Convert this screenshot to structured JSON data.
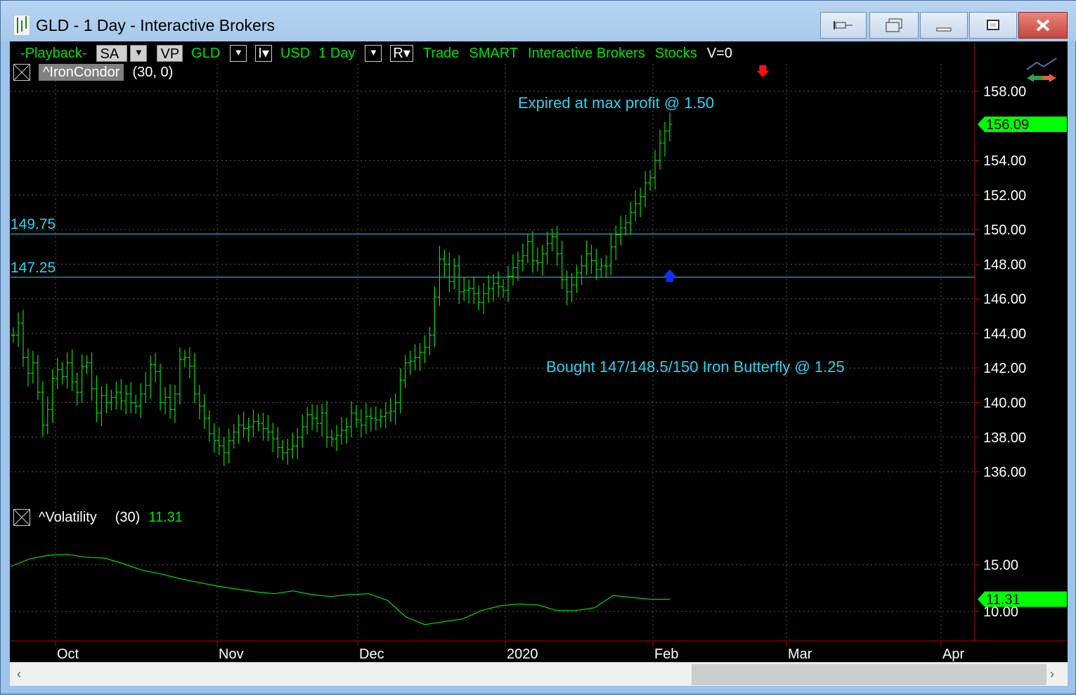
{
  "window": {
    "title": "GLD - 1 Day - Interactive Brokers",
    "buttons": [
      "pin-icon",
      "restore-window-icon",
      "minimize-icon",
      "maximize-icon",
      "close-icon"
    ]
  },
  "toolbar": {
    "playback": "-Playback-",
    "sa": "SA",
    "vp": "VP",
    "symbol": "GLD",
    "i_label": "I",
    "currency": "USD",
    "interval": "1 Day",
    "r_label": "R",
    "trade": "Trade",
    "route": "SMART",
    "broker": "Interactive Brokers",
    "asset": "Stocks",
    "volume": "V=0"
  },
  "price_study": {
    "name": "^IronCondor",
    "params": "(30,  0)"
  },
  "vol_study": {
    "name": "^Volatility",
    "params": "(30)",
    "value": "11.31"
  },
  "colors": {
    "bars": "#00e000",
    "annotation": "#2ad4f0",
    "axis": "#c00000",
    "grid": "#505050",
    "marker_sell": "#ff1010",
    "marker_buy": "#1030ff"
  },
  "chart_data": [
    {
      "type": "ohlc",
      "name": "GLD daily",
      "x_labels": [
        "Oct",
        "Nov",
        "Dec",
        "2020",
        "Feb",
        "Mar",
        "Apr"
      ],
      "y_ticks": [
        "158.00",
        "154.00",
        "152.00",
        "150.00",
        "148.00",
        "146.00",
        "144.00",
        "142.00",
        "140.00",
        "138.00",
        "136.00"
      ],
      "ylim": [
        134.5,
        159.5
      ],
      "last_price": "156.09",
      "lines": [
        {
          "value": 149.75,
          "label": "149.75"
        },
        {
          "value": 147.25,
          "label": "147.25"
        }
      ],
      "annotations": [
        {
          "text": "Expired at max profit @ 1.50"
        },
        {
          "text": "Bought 147/148.5/150 Iron Butterfly @ 1.25"
        }
      ],
      "markers": [
        {
          "kind": "sell",
          "bar": 153,
          "price": 158.7
        },
        {
          "kind": "buy",
          "bar": 134,
          "price": 147.3
        }
      ],
      "closes": [
        143.9,
        144.6,
        142.6,
        141.7,
        142.3,
        140.6,
        138.7,
        139.6,
        141.4,
        141.9,
        141.5,
        142.3,
        141.2,
        140.6,
        142.1,
        142.3,
        140.8,
        139.4,
        140.4,
        140.0,
        140.3,
        140.6,
        140.1,
        140.5,
        140.0,
        139.8,
        140.5,
        141.0,
        142.2,
        141.8,
        140.0,
        140.3,
        139.6,
        140.5,
        142.5,
        142.6,
        142.1,
        140.5,
        139.8,
        139.1,
        138.2,
        137.8,
        137.5,
        137.1,
        137.8,
        138.3,
        138.7,
        138.5,
        138.6,
        138.9,
        138.8,
        138.5,
        138.3,
        137.9,
        137.4,
        137.1,
        137.3,
        137.5,
        138.0,
        138.6,
        139.3,
        139.1,
        138.8,
        139.4,
        138.0,
        137.9,
        138.1,
        138.4,
        138.6,
        139.4,
        139.0,
        138.7,
        139.2,
        139.1,
        139.0,
        139.2,
        139.4,
        139.5,
        140.0,
        141.3,
        142.3,
        142.4,
        142.6,
        142.9,
        143.2,
        143.9,
        146.1,
        148.3,
        148.0,
        147.0,
        147.9,
        146.4,
        146.5,
        146.6,
        146.3,
        145.8,
        146.3,
        146.6,
        146.9,
        146.7,
        146.5,
        147.3,
        147.8,
        148.2,
        148.5,
        149.3,
        148.2,
        148.1,
        148.6,
        149.2,
        149.6,
        148.6,
        147.1,
        146.4,
        146.8,
        147.5,
        147.9,
        148.6,
        148.2,
        147.7,
        147.9,
        147.9,
        149.0,
        149.7,
        150.1,
        150.4,
        151.0,
        151.5,
        151.9,
        152.7,
        153.0,
        154.0,
        155.0,
        155.7,
        156.09
      ],
      "series_vol": {
        "name": "^Volatility",
        "y_ticks": [
          "15.00",
          "10.00"
        ],
        "ylim": [
          7.0,
          19.0
        ],
        "last": "11.31"
      }
    }
  ]
}
